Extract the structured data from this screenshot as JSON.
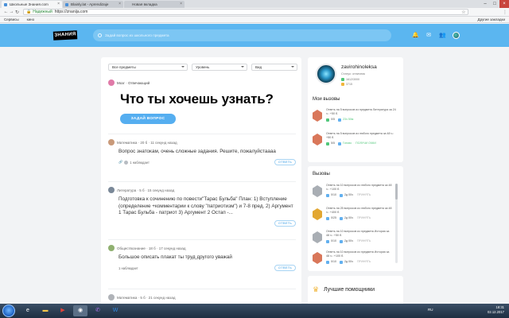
{
  "browser": {
    "tabs": [
      {
        "label": "Школьные Знания.com",
        "active": true
      },
      {
        "label": "Blainly.lat - Aprendizaje",
        "active": false
      },
      {
        "label": "Новая вкладка",
        "active": false
      }
    ],
    "secure_label": "Надежный",
    "url": "https://znanija.com",
    "bookmarks": [
      "Сервисы",
      "кино"
    ],
    "other_bookmarks": "Другие закладки"
  },
  "header": {
    "logo": "ЗНАНИЯ",
    "search_placeholder": "Задай вопрос из школьного предмета",
    "colors": {
      "header_bg": "#5bb6f0",
      "accent": "#55aef0"
    }
  },
  "filters": [
    "Все предметы",
    "Уровень",
    "Вид"
  ],
  "hero": {
    "user_line": "Мозг · Отвечающий",
    "title": "Что ты хочешь узнать?",
    "ask_button": "ЗАДАЙ ВОПРОС"
  },
  "questions": [
    {
      "meta": "Математика · 20 б · 11 секунд назад",
      "text": "Вопрос знатокам, очень сложные задания. Решите, пожалуйстаааа",
      "observers": "1 наблюдает",
      "answer_label": "ОТВЕТЬ"
    },
    {
      "meta": "Литература · 5 б · 15 секунд назад",
      "text": "Подготовка к сочинению по повести\"Тарас Бульба\" План: 1) Вступление (определение +комментарии к слову \"патриотизм\") и 7-8 пред. 2) Аргумент 1 Тарас Бульба - патриот 3) Аргумент 2 Остап -...",
      "observers": "",
      "answer_label": "ОТВЕТЬ"
    },
    {
      "meta": "Обществознание · 18 б · 17 секунд назад",
      "text": "Большое описать плакат ты труд другого уважай",
      "observers": "1 наблюдает",
      "answer_label": "ОТВЕТЬ"
    },
    {
      "meta": "Математика · 5 б · 21 секунд назад",
      "text": "",
      "observers": "",
      "answer_label": ""
    }
  ],
  "profile": {
    "name": "zavirohinoleksa",
    "status": "Статус: отличник",
    "points": "1612/3000",
    "points_extra": "3715",
    "my_challenges_title": "Мои вызовы",
    "my_challenges": [
      {
        "text": "Ответь на 5 вопросов из предмета Литература за 24 ч.: +50 б.",
        "progress": "0/5",
        "time": "23ч 50м",
        "link": ""
      },
      {
        "text": "Ответь на 5 вопросов из любого предмета за 48 ч.: +50 б.",
        "progress": "5/5",
        "time": "Готово",
        "link": "ПОЛУЧИ ОЧКИ"
      }
    ]
  },
  "challenges": {
    "title": "Вызовы",
    "items": [
      {
        "text": "Ответь на 10 вопросов из любого предмета за 48 ч.: +100 б.",
        "progress": "0/10",
        "time": "2д 00ч",
        "action": "ПРИНЯТЬ"
      },
      {
        "text": "Ответь на 25 вопросов из любого предмета за 48 ч.: +400 б.",
        "progress": "0/25",
        "time": "2д 00ч",
        "action": "ПРИНЯТЬ"
      },
      {
        "text": "Ответь на 10 вопросов из предмета История за 48 ч.: +50 б.",
        "progress": "0/10",
        "time": "2д 00ч",
        "action": "ПРИНЯТЬ"
      },
      {
        "text": "Ответь на 10 вопросов из предмета История за 48 ч.: +100 б.",
        "progress": "0/10",
        "time": "2д 00ч",
        "action": "ПРИНЯТЬ"
      }
    ]
  },
  "best_helpers_title": "Лучшие помощники",
  "taskbar": {
    "lang": "RU",
    "time": "18:31",
    "date": "02.12.2017"
  }
}
